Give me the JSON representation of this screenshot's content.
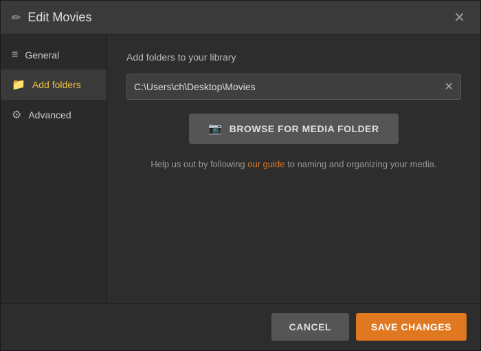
{
  "dialog": {
    "title": "Edit Movies",
    "title_icon": "✏",
    "close_icon": "✕"
  },
  "sidebar": {
    "items": [
      {
        "id": "general",
        "label": "General",
        "icon": "≡",
        "icon_type": "menu",
        "active": false
      },
      {
        "id": "add-folders",
        "label": "Add folders",
        "icon": "📁",
        "icon_type": "folder",
        "active": true
      },
      {
        "id": "advanced",
        "label": "Advanced",
        "icon": "⚙",
        "icon_type": "gear",
        "active": false
      }
    ]
  },
  "main": {
    "section_label": "Add folders to your library",
    "folder_path": "C:\\Users\\ch\\Desktop\\Movies",
    "folder_clear_icon": "✕",
    "browse_button_label": "BROWSE FOR MEDIA FOLDER",
    "browse_icon": "📷",
    "help_text_before": "Help us out by following ",
    "help_link_label": "our guide",
    "help_text_after": " to naming and organizing your media."
  },
  "footer": {
    "cancel_label": "CANCEL",
    "save_label": "SAVE CHANGES"
  }
}
